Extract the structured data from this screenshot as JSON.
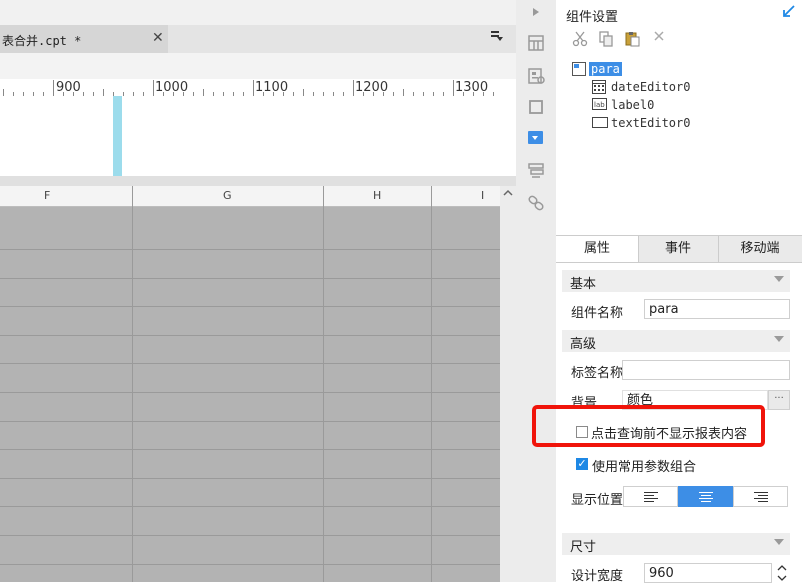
{
  "editor": {
    "tab_title": "表合并.cpt *",
    "tab_close": "✕",
    "tab_menu": "▾",
    "ruler_labels": [
      "900",
      "1000",
      "1100",
      "1200",
      "1300"
    ],
    "columns": [
      "F",
      "G",
      "H",
      "I"
    ]
  },
  "panel": {
    "title": "组件设置",
    "tree": {
      "root": "para",
      "children": [
        "dateEditor0",
        "label0",
        "textEditor0"
      ]
    },
    "tabs": [
      "属性",
      "事件",
      "移动端"
    ],
    "sections": {
      "basic": "基本",
      "advanced": "高级",
      "size": "尺寸"
    },
    "fields": {
      "name_label": "组件名称",
      "name_value": "para",
      "tag_label": "标签名称",
      "tag_value": "",
      "bg_label": "背景",
      "bg_value": "颜色",
      "bg_button": "···",
      "hide_before_query": "点击查询前不显示报表内容",
      "use_common_params": "使用常用参数组合",
      "position_label": "显示位置",
      "design_width_label": "设计宽度",
      "design_width_value": "960"
    },
    "hide_before_query_checked": false,
    "use_common_params_checked": true,
    "position_selected": "center",
    "colors": {
      "accent": "#3d8ee6",
      "highlight": "#f0140a"
    }
  }
}
